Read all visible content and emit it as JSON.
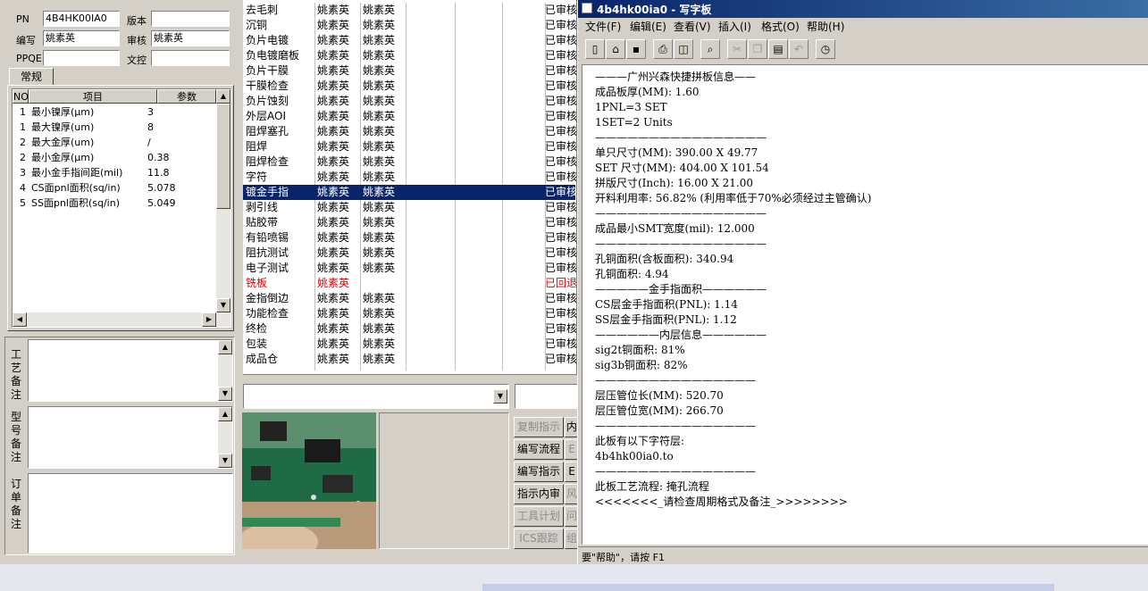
{
  "header": {
    "pn_label": "PN",
    "pn_value": "4B4HK00IA0",
    "version_label": "版本",
    "version_value": "",
    "author_label": "编写",
    "author_value": "姚素英",
    "review_label": "审核",
    "review_value": "姚素英",
    "ppqe_label": "PPQE",
    "ppqe_value": "",
    "doc_label": "文控",
    "doc_value": ""
  },
  "tabs": {
    "general": "常规"
  },
  "params": {
    "col_no": "NO",
    "col_item": "项目",
    "col_param": "参数",
    "rows": [
      {
        "no": "1",
        "item": "最小镍厚(μm)",
        "value": "3"
      },
      {
        "no": "1",
        "item": "最大镍厚(um)",
        "value": "8"
      },
      {
        "no": "2",
        "item": "最大金厚(um)",
        "value": "/"
      },
      {
        "no": "2",
        "item": "最小金厚(μm)",
        "value": "0.38"
      },
      {
        "no": "3",
        "item": "最小金手指间距(mil)",
        "value": "11.8"
      },
      {
        "no": "4",
        "item": "CS面pnl面积(sq/in)",
        "value": "5.078"
      },
      {
        "no": "5",
        "item": "SS面pnl面积(sq/in)",
        "value": "5.049"
      }
    ]
  },
  "notes": {
    "process": "工艺备注",
    "model": "型号备注",
    "order": "订单备注"
  },
  "process": {
    "rows": [
      {
        "step": "去毛刺",
        "a": "姚素英",
        "b": "姚素英",
        "status": "已审核"
      },
      {
        "step": "沉铜",
        "a": "姚素英",
        "b": "姚素英",
        "status": "已审核"
      },
      {
        "step": "负片电镀",
        "a": "姚素英",
        "b": "姚素英",
        "status": "已审核"
      },
      {
        "step": "负电镀磨板",
        "a": "姚素英",
        "b": "姚素英",
        "status": "已审核"
      },
      {
        "step": "负片干膜",
        "a": "姚素英",
        "b": "姚素英",
        "status": "已审核"
      },
      {
        "step": "干膜检查",
        "a": "姚素英",
        "b": "姚素英",
        "status": "已审核"
      },
      {
        "step": "负片蚀刻",
        "a": "姚素英",
        "b": "姚素英",
        "status": "已审核"
      },
      {
        "step": "外层AOI",
        "a": "姚素英",
        "b": "姚素英",
        "status": "已审核"
      },
      {
        "step": "阻焊塞孔",
        "a": "姚素英",
        "b": "姚素英",
        "status": "已审核"
      },
      {
        "step": "阻焊",
        "a": "姚素英",
        "b": "姚素英",
        "status": "已审核"
      },
      {
        "step": "阻焊检查",
        "a": "姚素英",
        "b": "姚素英",
        "status": "已审核"
      },
      {
        "step": "字符",
        "a": "姚素英",
        "b": "姚素英",
        "status": "已审核"
      },
      {
        "step": "镀金手指",
        "a": "姚素英",
        "b": "姚素英",
        "status": "已审核"
      },
      {
        "step": "剥引线",
        "a": "姚素英",
        "b": "姚素英",
        "status": "已审核"
      },
      {
        "step": "贴胶带",
        "a": "姚素英",
        "b": "姚素英",
        "status": "已审核"
      },
      {
        "step": "有铅喷锡",
        "a": "姚素英",
        "b": "姚素英",
        "status": "已审核"
      },
      {
        "step": "阻抗测试",
        "a": "姚素英",
        "b": "姚素英",
        "status": "已审核"
      },
      {
        "step": "电子测试",
        "a": "姚素英",
        "b": "姚素英",
        "status": "已审核"
      },
      {
        "step": "铣板",
        "a": "姚素英",
        "b": "",
        "status": "已回退"
      },
      {
        "step": "金指倒边",
        "a": "姚素英",
        "b": "姚素英",
        "status": "已审核"
      },
      {
        "step": "功能检查",
        "a": "姚素英",
        "b": "姚素英",
        "status": "已审核"
      },
      {
        "step": "终检",
        "a": "姚素英",
        "b": "姚素英",
        "status": "已审核"
      },
      {
        "step": "包装",
        "a": "姚素英",
        "b": "姚素英",
        "status": "已审核"
      },
      {
        "step": "成品仓",
        "a": "姚素英",
        "b": "姚素英",
        "status": "已审核"
      }
    ]
  },
  "buttons": {
    "copy_instr": "复制指示",
    "c1": "内",
    "edit_flow": "编写流程",
    "c2": "E",
    "edit_instr": "编写指示",
    "c3": "E",
    "instr_review": "指示内审",
    "c4": "风",
    "tool_plan": "工具计划",
    "c5": "问",
    "ics_track": "ICS跟踪",
    "c6": "组"
  },
  "wordpad": {
    "title": "4b4hk00ia0 - 写字板",
    "menu": [
      "文件(F)",
      "编辑(E)",
      "查看(V)",
      "插入(I)",
      "格式(O)",
      "帮助(H)"
    ],
    "status": "要\"帮助\"，请按 F1",
    "lines": [
      "———广州兴森快捷拼板信息——",
      "成品板厚(MM): 1.60",
      "1PNL=3 SET",
      "1SET=2 Units",
      "————————————————",
      "单只尺寸(MM): 390.00 X 49.77",
      "SET 尺寸(MM): 404.00 X 101.54",
      "拼版尺寸(Inch): 16.00 X 21.00",
      "开料利用率: 56.82% (利用率低于70%必须经过主管确认)",
      "————————————————",
      "成品最小SMT宽度(mil): 12.000",
      "————————————————",
      "孔铜面积(含板面积): 340.94",
      "孔铜面积: 4.94",
      "—————金手指面积——————",
      "CS层金手指面积(PNL): 1.14",
      "SS层金手指面积(PNL): 1.12",
      "——————内层信息——————",
      "sig2t铜面积: 81%",
      "sig3b铜面积: 82%",
      "———————————————",
      "层压管位长(MM): 520.70",
      "层压管位宽(MM): 266.70",
      "———————————————",
      "此板有以下字符层:",
      "4b4hk00ia0.to",
      "———————————————",
      "此板工艺流程: 掩孔流程",
      "<<<<<<<_请检查周期格式及备注_>>>>>>>>"
    ]
  },
  "colors": {
    "selection": "#0a246a",
    "title_bar": "#0a246a",
    "returned": "#e00000",
    "desktop_bg": "#d4d0c8"
  }
}
